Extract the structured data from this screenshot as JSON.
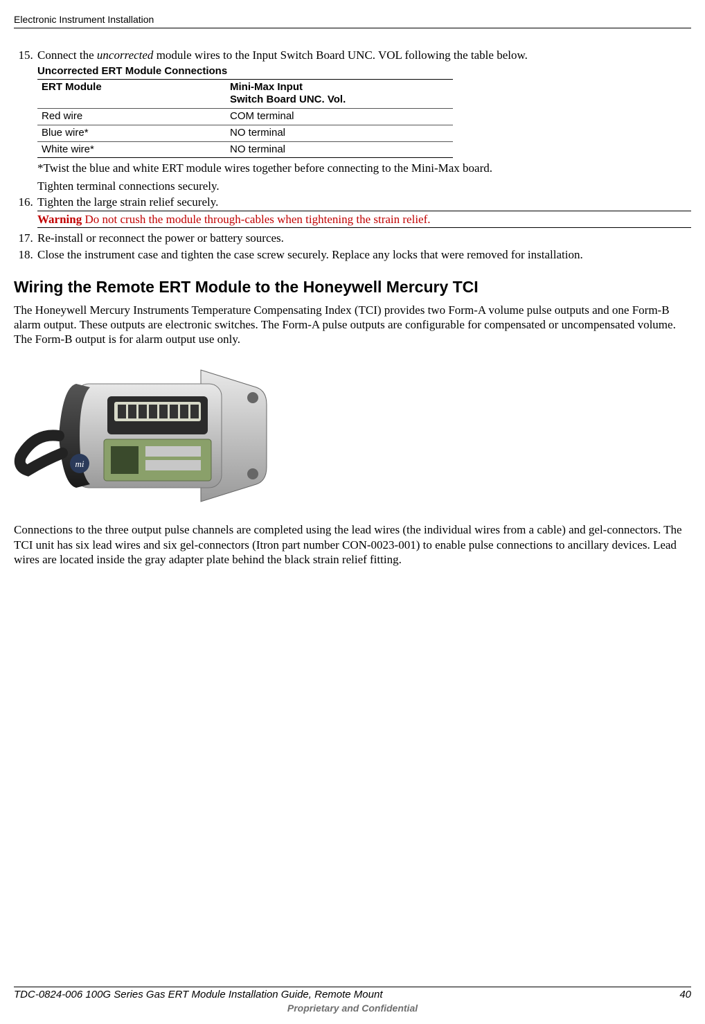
{
  "header": {
    "title": "Electronic Instrument Installation"
  },
  "steps": {
    "s15_prefix": "Connect the ",
    "s15_italic": "uncorrected",
    "s15_suffix": " module wires to the Input Switch Board UNC. VOL following the table below.",
    "table_caption": "Uncorrected ERT Module Connections",
    "table_header_col1": "ERT Module",
    "table_header_col2a": "Mini-Max Input",
    "table_header_col2b": "Switch Board UNC. Vol.",
    "rows": [
      {
        "c1": "Red wire",
        "c2": "COM terminal"
      },
      {
        "c1": "Blue wire*",
        "c2": "NO terminal"
      },
      {
        "c1": "White wire*",
        "c2": "NO terminal"
      }
    ],
    "note_twist": "*Twist the blue and white ERT module wires together before connecting to the Mini-Max board.",
    "note_tighten": "Tighten terminal connections securely.",
    "s16": "Tighten the large strain relief securely.",
    "warning_label": "Warning",
    "warning_text": "  Do not crush the module through-cables when tightening the strain relief.",
    "s17": "Re-install or reconnect the power or battery sources.",
    "s18": "Close the instrument case and tighten the case screw securely. Replace any locks that were removed for installation."
  },
  "section": {
    "heading": "Wiring the Remote ERT Module to the Honeywell Mercury TCI",
    "para1": "The Honeywell Mercury Instruments Temperature Compensating Index (TCI) provides two Form-A volume pulse outputs and one Form-B alarm output. These outputs are electronic switches. The Form-A pulse outputs are configurable for compensated or uncompensated volume. The Form-B output is for alarm output use only.",
    "para2": "Connections to the three output pulse channels are completed using the lead wires (the individual wires from a cable) and gel-connectors. The TCI unit has six lead wires and six gel-connectors (Itron part number CON-0023-001) to enable pulse connections to ancillary devices. Lead wires are located inside the gray adapter plate behind the black strain relief fitting."
  },
  "footer": {
    "doc_id": "TDC-0824-006 100G Series Gas ERT Module Installation Guide, Remote Mount",
    "page": "40",
    "confidential": "Proprietary and Confidential"
  }
}
